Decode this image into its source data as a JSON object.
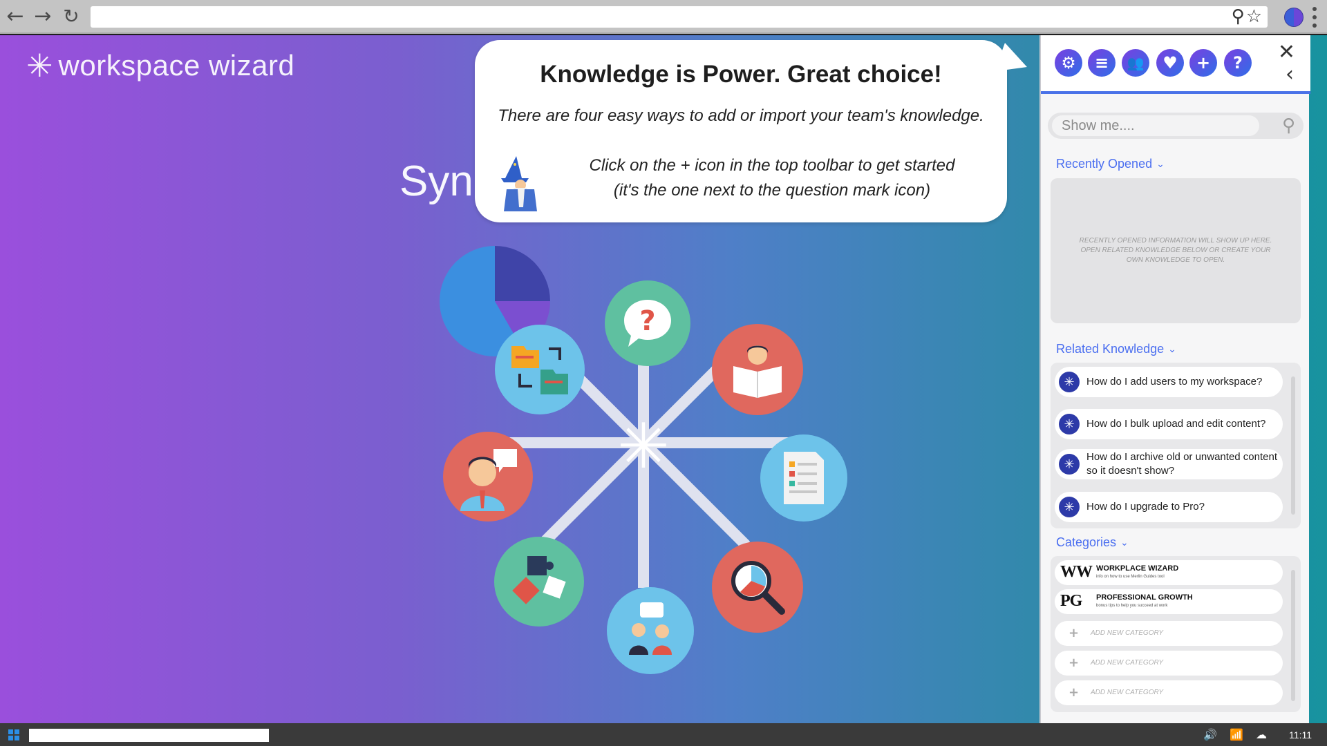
{
  "browser": {
    "back_icon": "arrow-left-icon",
    "forward_icon": "arrow-right-icon",
    "reload_icon": "reload-icon",
    "url": "",
    "search_icon": "search-icon",
    "bookmark_icon": "star-icon"
  },
  "page": {
    "brand_name": "workspace wizard",
    "hero_title": "Sync",
    "hub_icons": [
      "question-icon",
      "customer-reading-icon",
      "document-icon",
      "search-chart-icon",
      "team-chat-icon",
      "puzzle-icon",
      "support-agent-icon",
      "folders-icon"
    ]
  },
  "bubble": {
    "title": "Knowledge is Power. Great choice!",
    "subtitle": "There are four easy ways to add or import your team's knowledge.",
    "instruction_line1": "Click on the + icon in the top toolbar to get started",
    "instruction_line2": "(it's the one next to the question mark icon)"
  },
  "panel": {
    "toolbar_icons": [
      "gear-icon",
      "list-icon",
      "users-icon",
      "heart-icon",
      "plus-icon",
      "question-icon"
    ],
    "search_placeholder": "Show me....",
    "recently_opened": {
      "title": "Recently Opened",
      "empty_text": "RECENTLY OPENED INFORMATION WILL SHOW UP HERE. OPEN RELATED KNOWLEDGE BELOW OR CREATE YOUR OWN KNOWLEDGE TO OPEN."
    },
    "related_knowledge": {
      "title": "Related Knowledge",
      "items": [
        "How do I add users to my workspace?",
        "How do I bulk upload and edit content?",
        "How do I archive old or unwanted content so it doesn't show?",
        "How do I upgrade to Pro?"
      ]
    },
    "categories": {
      "title": "Categories",
      "items": [
        {
          "abbr": "WW",
          "name": "WORKPLACE WIZARD",
          "desc": "info on how to use Merlin Guides tool"
        },
        {
          "abbr": "PG",
          "name": "PROFESSIONAL GROWTH",
          "desc": "bonus tips to help you succeed at work"
        }
      ],
      "add_label": "ADD NEW CATEGORY"
    }
  },
  "taskbar": {
    "time": "11:11",
    "tray_icons": [
      "volume-icon",
      "wifi-icon",
      "cloud-icon"
    ]
  },
  "colors": {
    "accent": "#4a6ef0",
    "gradient_start": "#9a4fdc",
    "gradient_end": "#17939f"
  }
}
